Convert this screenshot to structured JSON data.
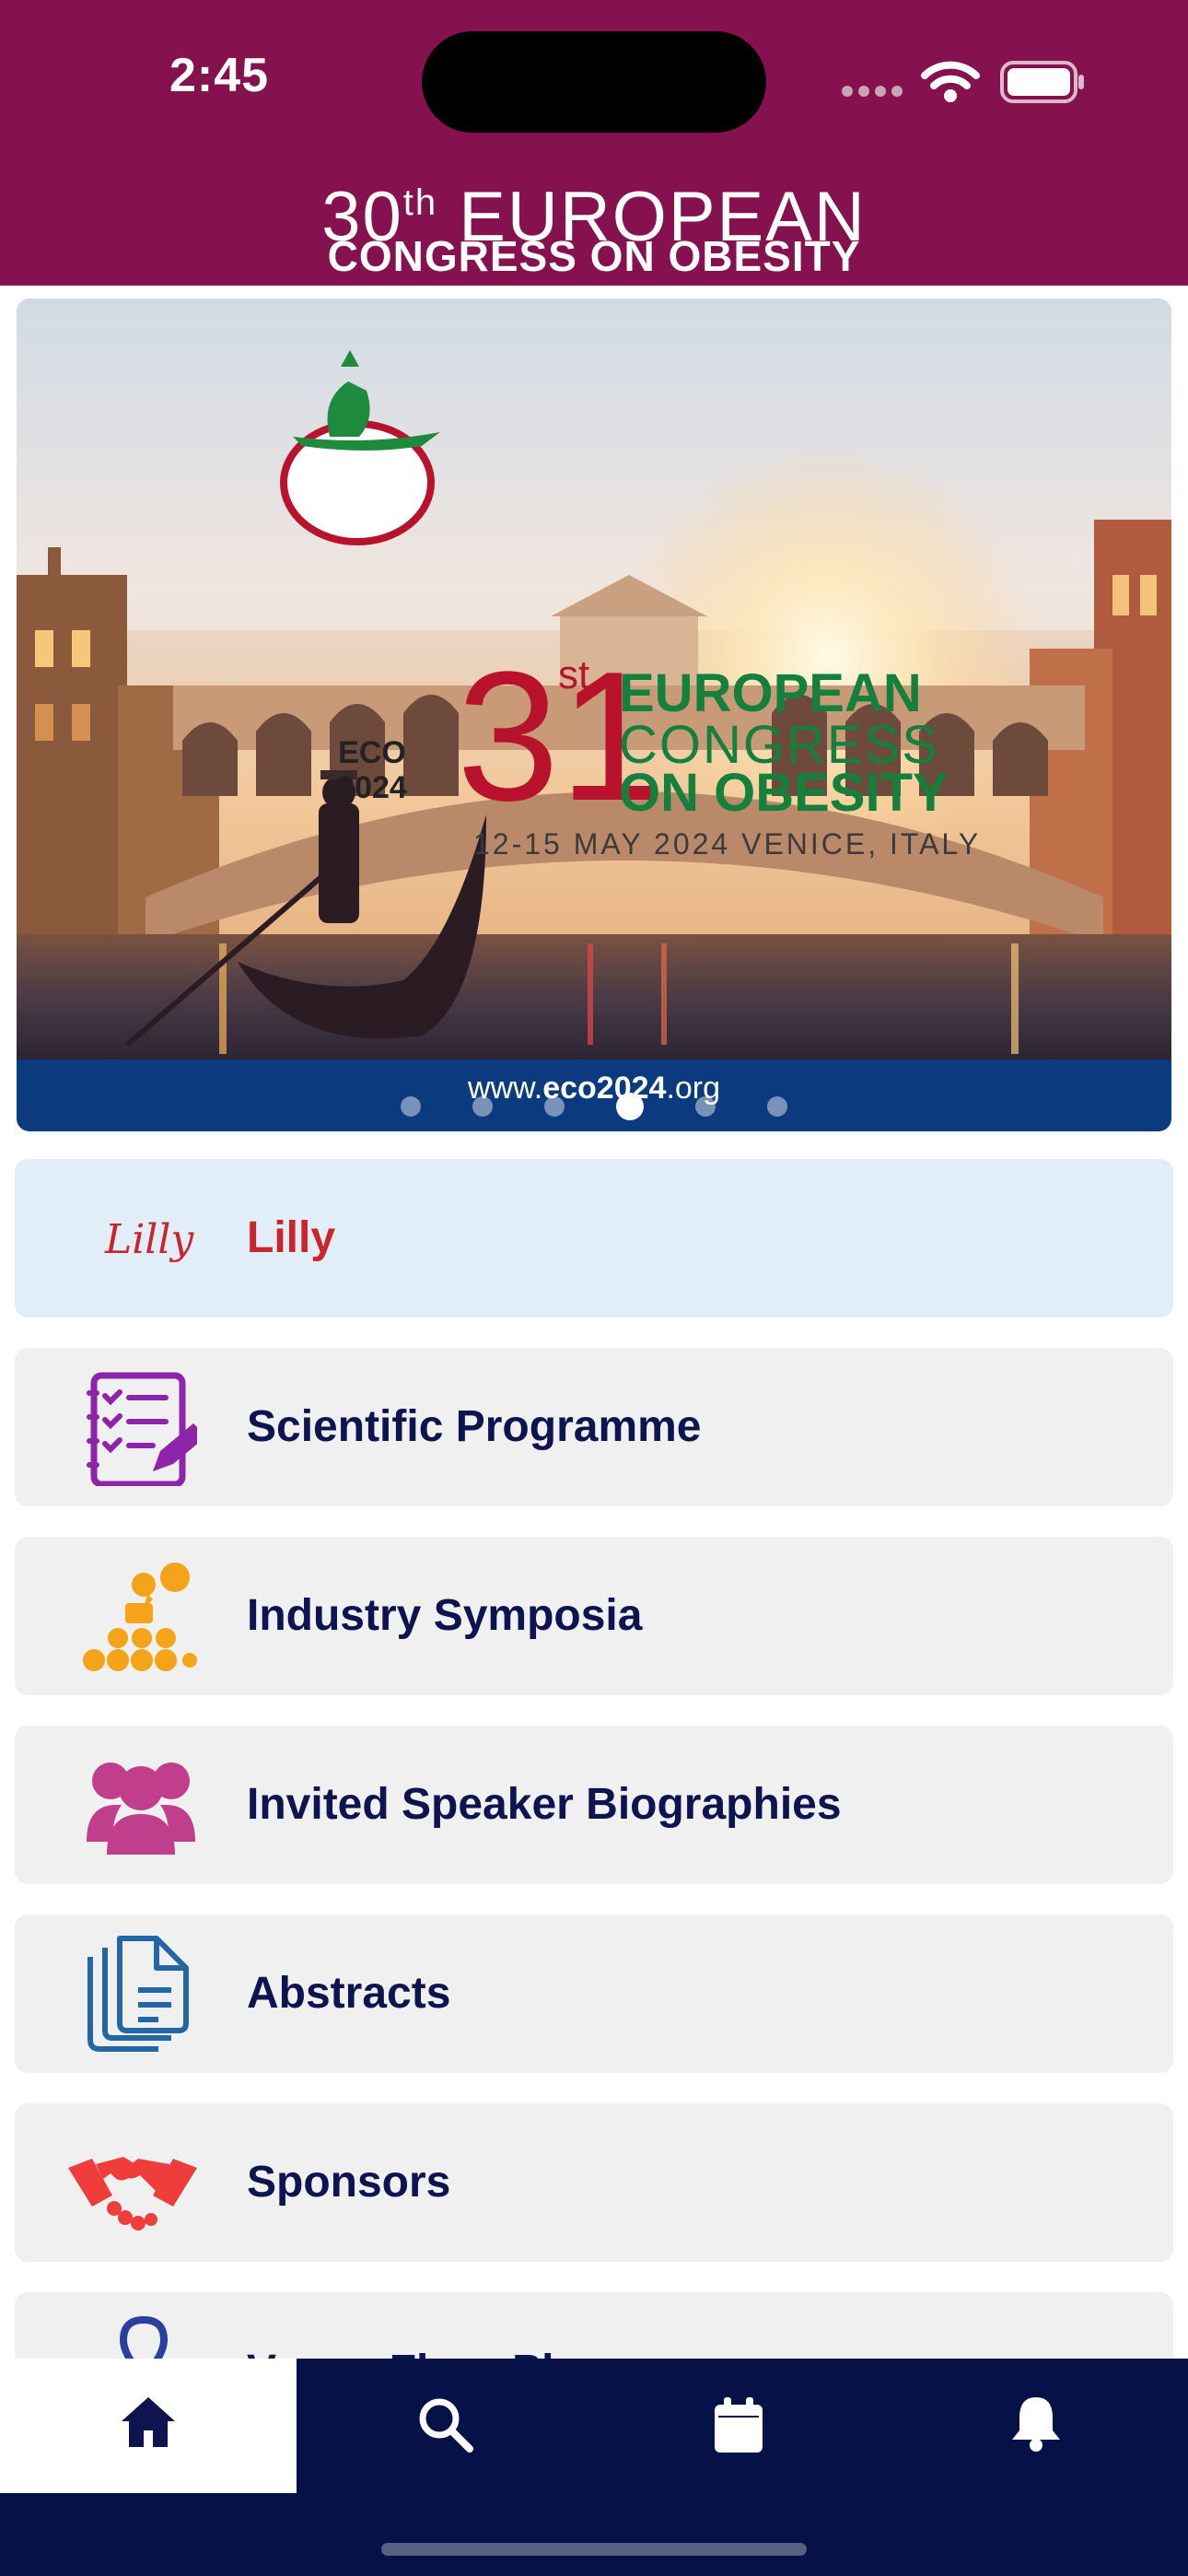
{
  "status_bar": {
    "time": "2:45"
  },
  "header": {
    "title_prefix": "30",
    "title_sup": "th",
    "title_rest": " EUROPEAN",
    "subtitle": "CONGRESS ON OBESITY"
  },
  "banner": {
    "badge_line1": "ECO",
    "badge_line2": "2024",
    "edition_num": "31",
    "edition_sup": "st",
    "line1": "EUROPEAN",
    "line2": "CONGRESS",
    "line3": "ON OBESITY",
    "date_place": "12-15 MAY 2024 VENICE, ITALY",
    "url_prefix": "www.",
    "url_bold": "eco2024",
    "url_suffix": ".org",
    "page_count": 6,
    "active_page": 4
  },
  "menu": [
    {
      "label": "Lilly",
      "icon": "lilly-logo"
    },
    {
      "label": "Scientific Programme",
      "icon": "checklist-icon"
    },
    {
      "label": "Industry Symposia",
      "icon": "audience-speaker-icon"
    },
    {
      "label": "Invited Speaker Biographies",
      "icon": "people-group-icon"
    },
    {
      "label": "Abstracts",
      "icon": "documents-icon"
    },
    {
      "label": "Sponsors",
      "icon": "handshake-icon"
    },
    {
      "label": "Venue Floor Plan",
      "icon": "map-pin-icon"
    }
  ],
  "lilly_logo_text": "Lilly",
  "tabs": [
    {
      "name": "home",
      "icon": "home-icon",
      "active": true
    },
    {
      "name": "search",
      "icon": "search-icon",
      "active": false
    },
    {
      "name": "calendar",
      "icon": "calendar-icon",
      "active": false
    },
    {
      "name": "notifications",
      "icon": "bell-icon",
      "active": false
    }
  ],
  "colors": {
    "header_bg": "#85124f",
    "tabbar_bg": "#061247",
    "menu_text": "#0d1450",
    "lilly_red": "#c8262b",
    "eco_green": "#14803c"
  }
}
